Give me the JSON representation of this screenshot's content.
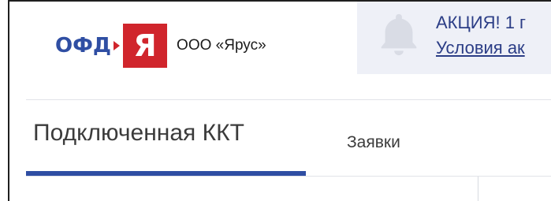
{
  "header": {
    "logo": {
      "brand_text": "ОФД",
      "brand_mark": "Я",
      "arrow_icon": "arrow-right-icon"
    },
    "company_name": "ООО «Ярус»"
  },
  "promo": {
    "icon": "bell-icon",
    "title": "АКЦИЯ! 1 г",
    "link_text": "Условия ак"
  },
  "tabs": [
    {
      "label": "Подключенная ККТ",
      "active": true
    },
    {
      "label": "Заявки",
      "active": false
    }
  ],
  "colors": {
    "brand_blue": "#2f4ea3",
    "brand_red": "#d0252c",
    "promo_bg": "#eef0f7",
    "promo_text": "#2b3d86"
  }
}
